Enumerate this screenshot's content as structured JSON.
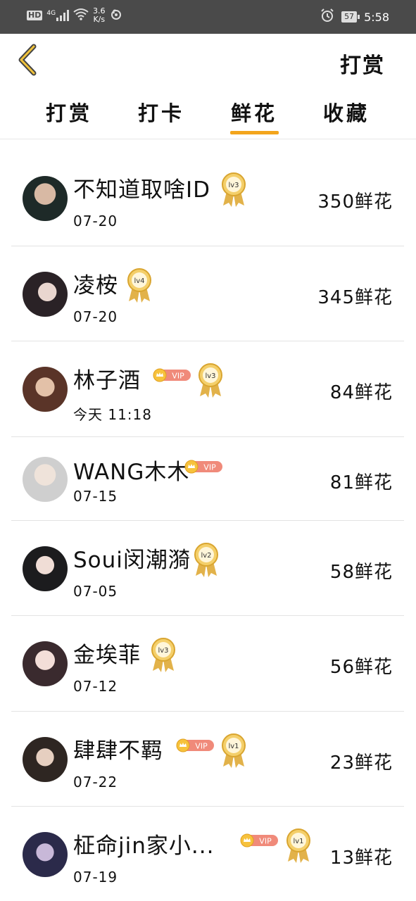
{
  "status_bar": {
    "hd": "HD",
    "network": "4G",
    "speed_value": "3.6",
    "speed_unit": "K/s",
    "battery": "57",
    "time": "5:58"
  },
  "header": {
    "title": "打赏"
  },
  "tabs": [
    {
      "label": "打赏",
      "active": false
    },
    {
      "label": "打卡",
      "active": false
    },
    {
      "label": "鲜花",
      "active": true
    },
    {
      "label": "收藏",
      "active": false
    }
  ],
  "accent_color": "#f3a51c",
  "rows": [
    {
      "name": "不知道取啥ID",
      "date": "07-20",
      "amount": "350鲜花",
      "vip": false,
      "vip_label": "",
      "level": "lv3",
      "avatar_color": "#1e2a28"
    },
    {
      "name": "凌桉",
      "date": "07-20",
      "amount": "345鲜花",
      "vip": false,
      "vip_label": "",
      "level": "lv4",
      "avatar_color": "#2a2226"
    },
    {
      "name": "林子酒",
      "date": "今天 11:18",
      "amount": "84鲜花",
      "vip": true,
      "vip_label": "VIP",
      "level": "lv3",
      "avatar_color": "#5a3428"
    },
    {
      "name": "WANG木木",
      "date": "07-15",
      "amount": "81鲜花",
      "vip": true,
      "vip_label": "VIP",
      "level": "",
      "avatar_color": "#cfcfcf"
    },
    {
      "name": "Soui闵潮漪",
      "date": "07-05",
      "amount": "58鲜花",
      "vip": false,
      "vip_label": "",
      "level": "lv2",
      "avatar_color": "#1c1c1e"
    },
    {
      "name": "金埃菲",
      "date": "07-12",
      "amount": "56鲜花",
      "vip": false,
      "vip_label": "",
      "level": "lv3",
      "avatar_color": "#3a2a2e"
    },
    {
      "name": "肆肆不羁",
      "date": "07-22",
      "amount": "23鲜花",
      "vip": true,
      "vip_label": "VIP",
      "level": "lv1",
      "avatar_color": "#2e2622"
    },
    {
      "name": "柾命jin家小...",
      "date": "07-19",
      "amount": "13鲜花",
      "vip": true,
      "vip_label": "VIP",
      "level": "lv1",
      "avatar_color": "#2b2a4a"
    }
  ]
}
